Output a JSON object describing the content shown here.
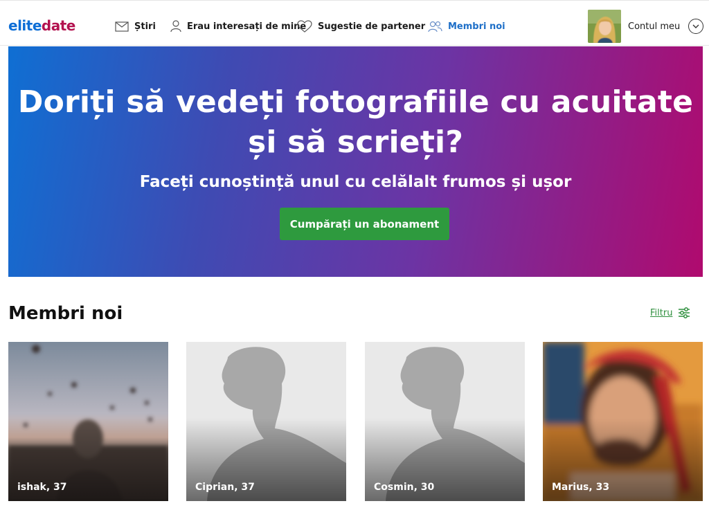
{
  "brand": {
    "logo_part1": "elite",
    "logo_part2": "date"
  },
  "nav": [
    {
      "label": "Știri",
      "icon": "envelope-icon"
    },
    {
      "label": "Erau interesați de mine",
      "icon": "person-icon"
    },
    {
      "label": "Sugestie de partener",
      "icon": "heart-icon"
    },
    {
      "label": "Membri noi",
      "icon": "people-icon",
      "active": true
    }
  ],
  "account": {
    "label": "Contul meu"
  },
  "hero": {
    "title": "Doriți să vedeți fotografiile cu acuitate și să scrieți?",
    "subtitle": "Faceți cunoștință unul cu celălalt frumos și ușor",
    "cta": "Cumpărați un abonament"
  },
  "section": {
    "title": "Membri noi",
    "filter_label": "Filtru"
  },
  "members": [
    {
      "name": "ishak, 37",
      "photo": "blurred-photo"
    },
    {
      "name": "Ciprian, 37",
      "photo": "placeholder"
    },
    {
      "name": "Cosmin, 30",
      "photo": "placeholder"
    },
    {
      "name": "Marius, 33",
      "photo": "blurred-photo"
    }
  ],
  "colors": {
    "brand_blue": "#0e6ed6",
    "brand_red": "#b3124f",
    "active_nav": "#1e6fc8",
    "cta_green": "#2e9a3e",
    "hero_gradient_start": "#0f6fd3",
    "hero_gradient_end": "#b00a6e"
  }
}
